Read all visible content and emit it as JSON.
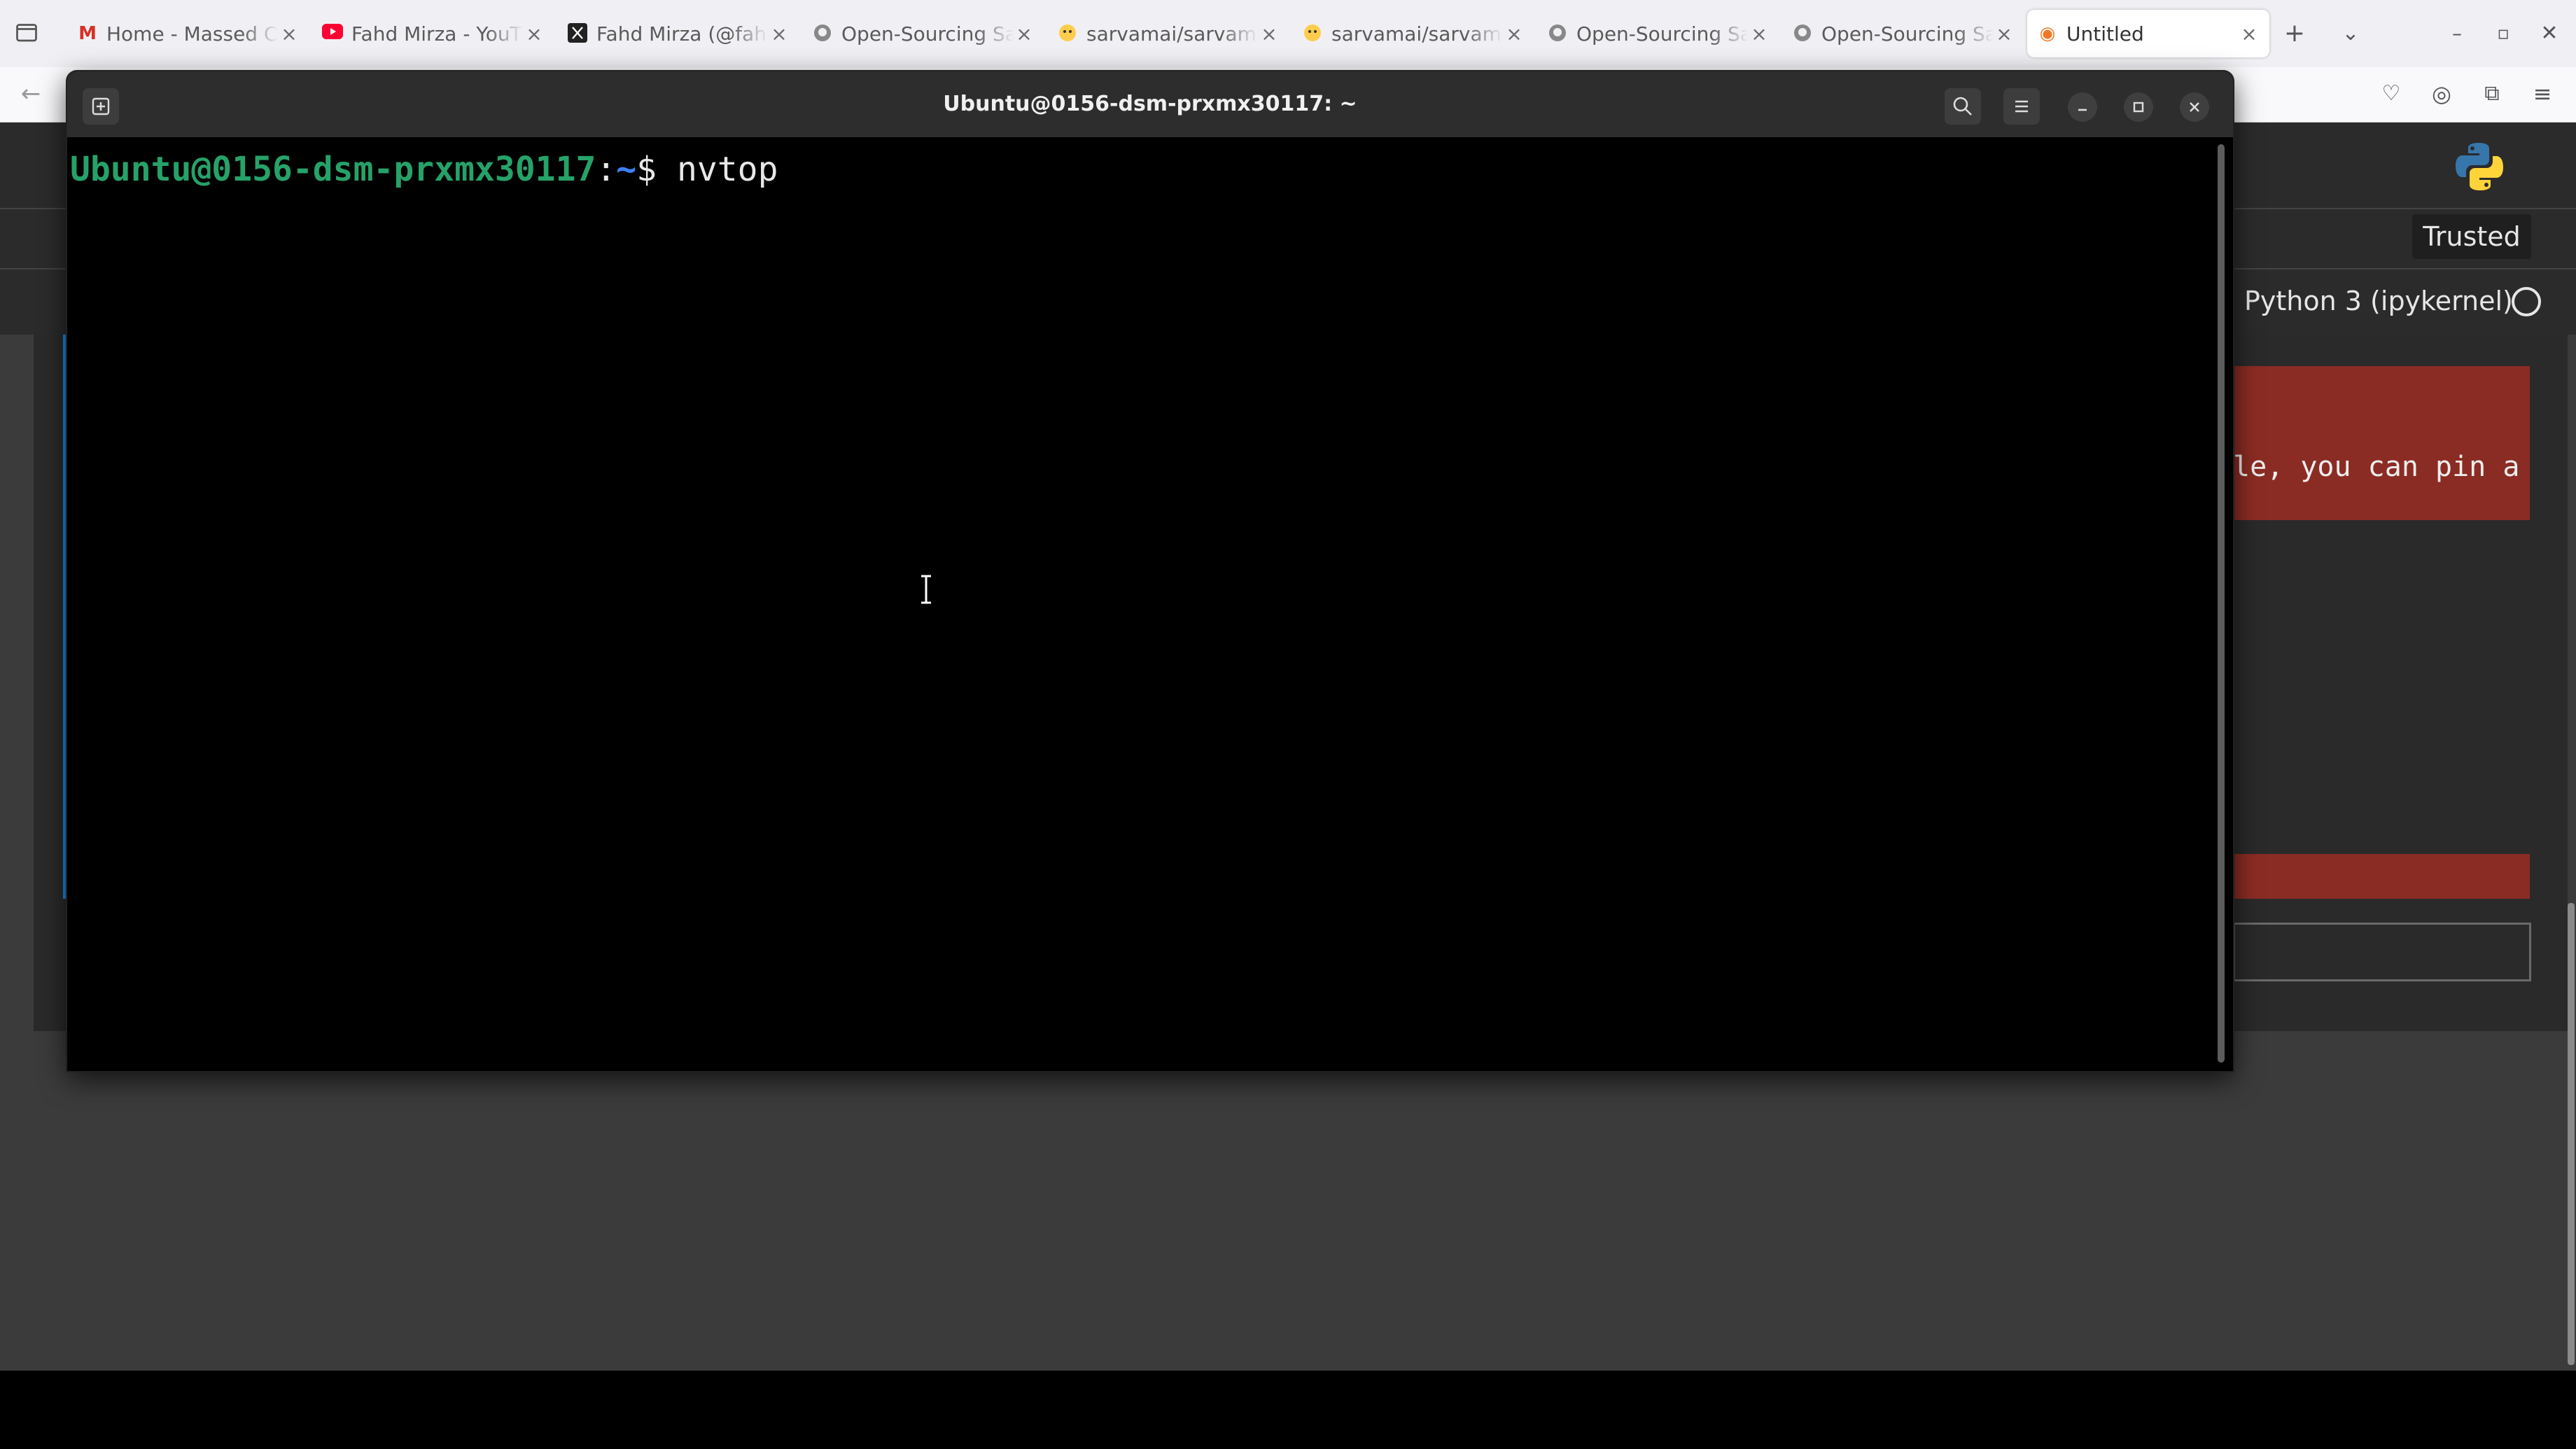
{
  "browser": {
    "tabs": [
      {
        "icon": "gmail-icon",
        "title": "Home - Massed C"
      },
      {
        "icon": "youtube-icon",
        "title": "Fahd Mirza - YouT"
      },
      {
        "icon": "x-icon",
        "title": "Fahd Mirza (@fah"
      },
      {
        "icon": "github-icon",
        "title": "Open-Sourcing Sa"
      },
      {
        "icon": "huggingface-icon",
        "title": "sarvamai/sarvam"
      },
      {
        "icon": "huggingface-icon",
        "title": "sarvamai/sarvam"
      },
      {
        "icon": "github-icon",
        "title": "Open-Sourcing Sa"
      },
      {
        "icon": "github-icon",
        "title": "Open-Sourcing Sa"
      },
      {
        "icon": "jupyter-icon",
        "title": "Untitled",
        "active": true
      }
    ],
    "close_glyph": "×",
    "new_tab_glyph": "+",
    "list_tabs_glyph": "⌄"
  },
  "jupyter": {
    "trusted_label": "Trusted",
    "kernel_label": "Python 3 (ipykernel)",
    "cell_output_fragment": "le, you can pin a"
  },
  "terminal": {
    "title": "Ubuntu@0156-dsm-prxmx30117: ~",
    "prompt_user": "Ubuntu@0156-dsm-prxmx30117",
    "prompt_sep": ":",
    "prompt_path": "~",
    "prompt_dollar": "$ ",
    "command": "nvtop"
  },
  "colors": {
    "prompt_user": "#26a269",
    "prompt_path": "#3b82f6",
    "terminal_bg": "#000000",
    "terminal_header": "#2d2d2d",
    "jupyter_error_red": "#8b2c24"
  }
}
